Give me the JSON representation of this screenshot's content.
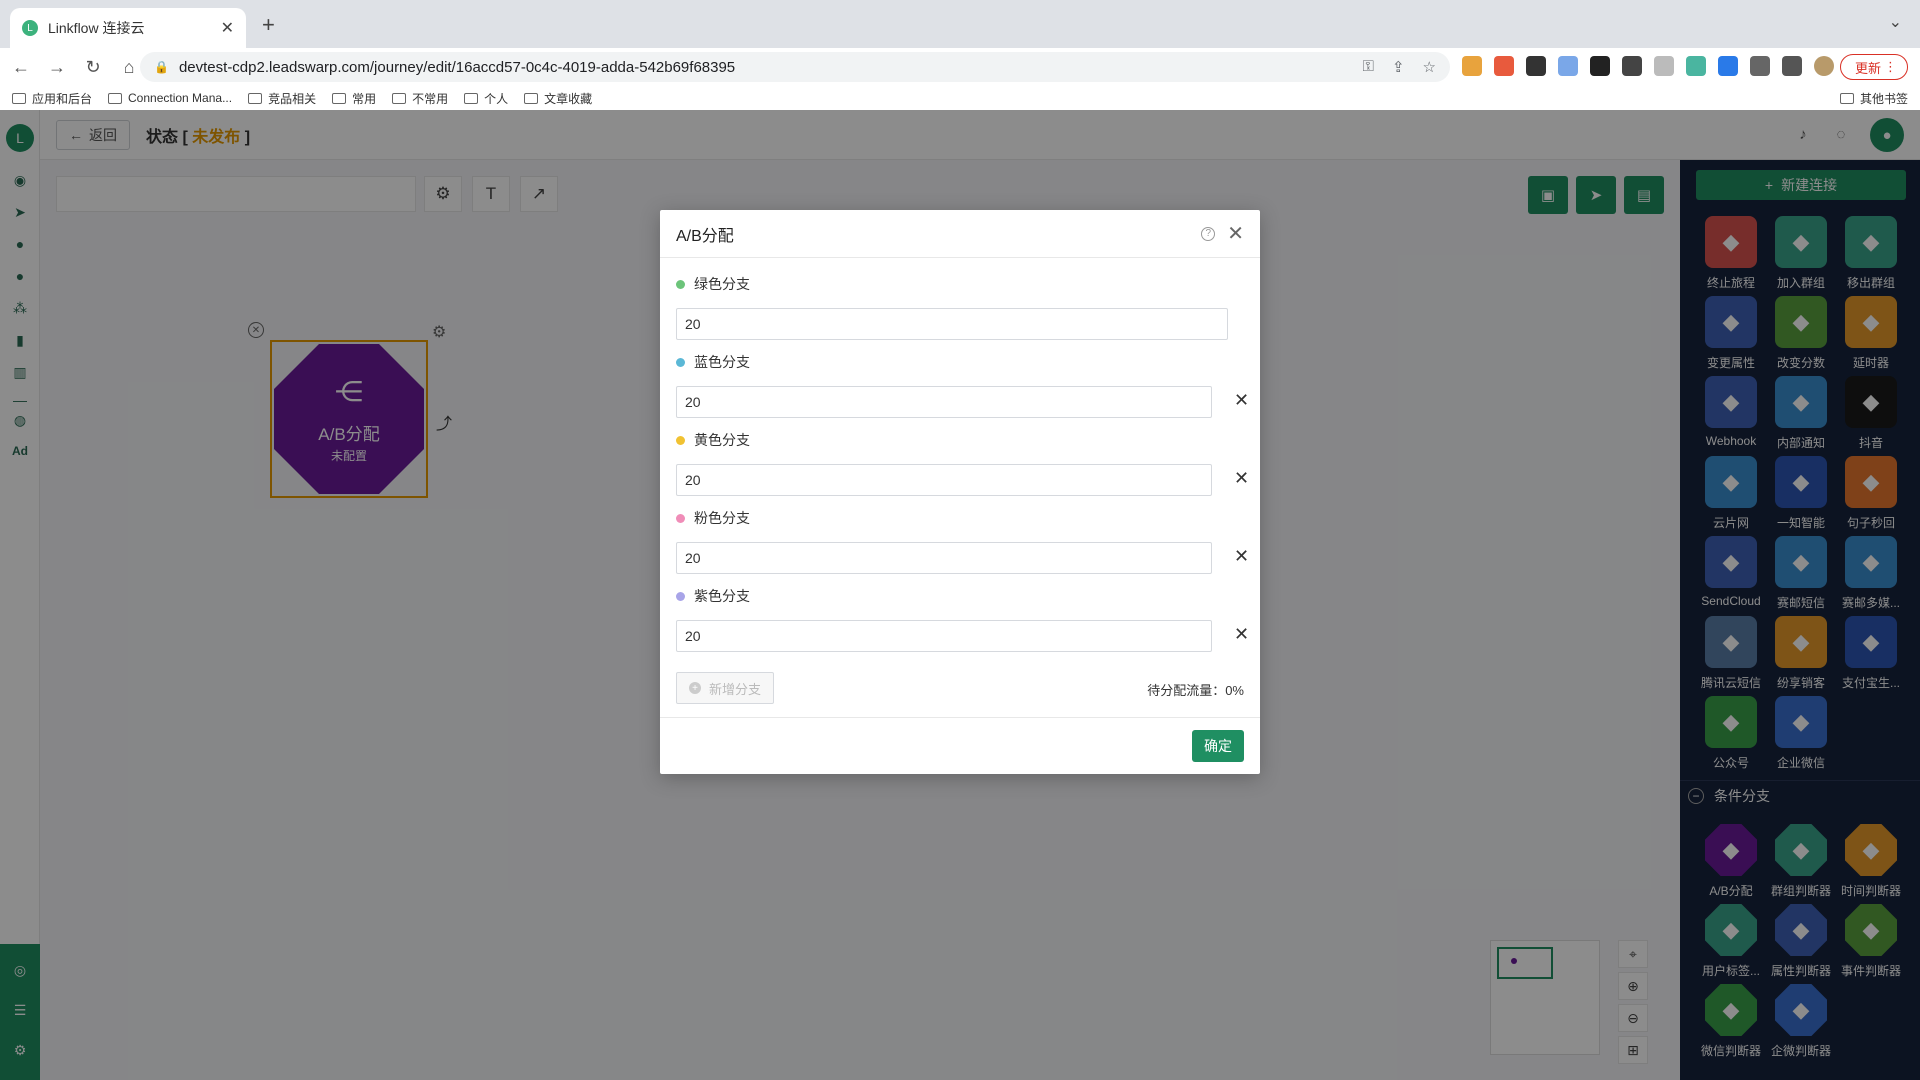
{
  "browser": {
    "tab_title": "Linkflow 连接云",
    "url": "devtest-cdp2.leadswarp.com/journey/edit/16accd57-0c4c-4019-adda-542b69f68395",
    "update_label": "更新",
    "bookmarks": [
      "应用和后台",
      "Connection Mana...",
      "竞品相关",
      "常用",
      "不常用",
      "个人",
      "文章收藏"
    ],
    "bookmarks_right": "其他书签"
  },
  "app": {
    "back_label": "返回",
    "status_label": "状态",
    "status_value": "未发布",
    "node": {
      "title": "A/B分配",
      "subtitle": "未配置"
    },
    "new_connection": "新建连接",
    "palette": [
      {
        "label": "终止旅程",
        "color": "#d9534f",
        "icon": "stop-icon"
      },
      {
        "label": "加入群组",
        "color": "#3aa58a",
        "icon": "user-plus-icon"
      },
      {
        "label": "移出群组",
        "color": "#3aa58a",
        "icon": "user-minus-icon"
      },
      {
        "label": "变更属性",
        "color": "#3f62b7",
        "icon": "edit-icon"
      },
      {
        "label": "改变分数",
        "color": "#5aa03f",
        "icon": "trophy-icon"
      },
      {
        "label": "延时器",
        "color": "#e59a2b",
        "icon": "hourglass-icon"
      },
      {
        "label": "Webhook",
        "color": "#3f62b7",
        "icon": "webhook-icon"
      },
      {
        "label": "内部通知",
        "color": "#3a8fd0",
        "icon": "bell-icon"
      },
      {
        "label": "抖音",
        "color": "#1a1a1a",
        "icon": "tiktok-icon"
      },
      {
        "label": "云片网",
        "color": "#3a8fd0",
        "icon": "cloud-icon"
      },
      {
        "label": "一知智能",
        "color": "#2c56b5",
        "icon": "yiwise-icon"
      },
      {
        "label": "句子秒回",
        "color": "#e8772e",
        "icon": "chat-bubble-icon"
      },
      {
        "label": "SendCloud",
        "color": "#3f62b7",
        "icon": "sendcloud-icon"
      },
      {
        "label": "赛邮短信",
        "color": "#3a8fd0",
        "icon": "ring-icon"
      },
      {
        "label": "赛邮多媒...",
        "color": "#3a8fd0",
        "icon": "ring-icon"
      },
      {
        "label": "腾讯云短信",
        "color": "#5a7fa8",
        "icon": "cloud-icon"
      },
      {
        "label": "纷享销客",
        "color": "#e59a2b",
        "icon": "fxiaoke-icon"
      },
      {
        "label": "支付宝生...",
        "color": "#2c56b5",
        "icon": "alipay-icon"
      },
      {
        "label": "公众号",
        "color": "#3aa14a",
        "icon": "wechat-icon"
      },
      {
        "label": "企业微信",
        "color": "#3a6fd0",
        "icon": "wecom-icon"
      }
    ],
    "condition_section": "条件分支",
    "conditions": [
      {
        "label": "A/B分配",
        "color": "#6a1b9a",
        "icon": "ab-split-icon"
      },
      {
        "label": "群组判断器",
        "color": "#3aa58a",
        "icon": "group-judge-icon"
      },
      {
        "label": "时间判断器",
        "color": "#e59a2b",
        "icon": "time-judge-icon"
      },
      {
        "label": "用户标签...",
        "color": "#3aa58a",
        "icon": "tag-judge-icon"
      },
      {
        "label": "属性判断器",
        "color": "#3f62b7",
        "icon": "edit-judge-icon"
      },
      {
        "label": "事件判断器",
        "color": "#5aa03f",
        "icon": "list-judge-icon"
      },
      {
        "label": "微信判断器",
        "color": "#3aa14a",
        "icon": "wechat-judge-icon"
      },
      {
        "label": "企微判断器",
        "color": "#3a6fd0",
        "icon": "wecom-judge-icon"
      }
    ]
  },
  "modal": {
    "title": "A/B分配",
    "branches": [
      {
        "label": "绿色分支",
        "color": "#6cc47a",
        "value": "20",
        "removable": false
      },
      {
        "label": "蓝色分支",
        "color": "#5bb8d6",
        "value": "20",
        "removable": true
      },
      {
        "label": "黄色分支",
        "color": "#f1c232",
        "value": "20",
        "removable": true
      },
      {
        "label": "粉色分支",
        "color": "#f08db8",
        "value": "20",
        "removable": true
      },
      {
        "label": "紫色分支",
        "color": "#a8a4e8",
        "value": "20",
        "removable": true
      }
    ],
    "add_branch": "新增分支",
    "remaining_label": "待分配流量：",
    "remaining_value": "0%",
    "confirm": "确定"
  }
}
